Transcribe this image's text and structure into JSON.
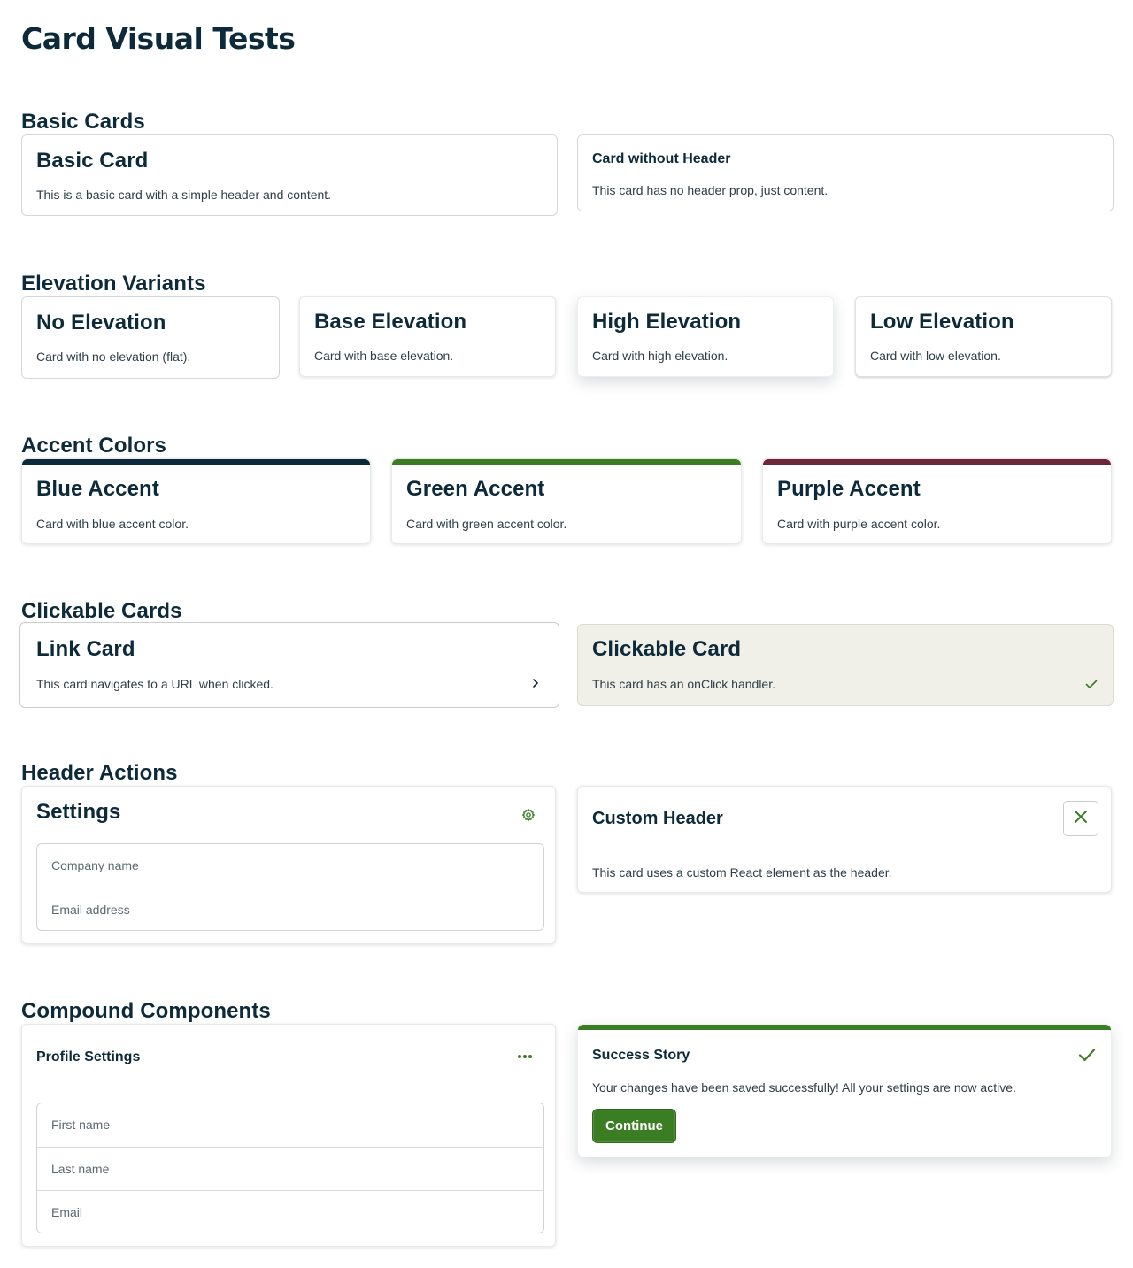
{
  "page": {
    "title": "Card Visual Tests"
  },
  "sections": {
    "basic": "Basic Cards",
    "elevation": "Elevation Variants",
    "accent": "Accent Colors",
    "clickable": "Clickable Cards",
    "header_actions": "Header Actions",
    "compound": "Compound Components"
  },
  "basic_cards": {
    "basic": {
      "title": "Basic Card",
      "body": "This is a basic card with a simple header and content."
    },
    "no_header": {
      "title": "Card without Header",
      "body": "This card has no header prop, just content."
    }
  },
  "elevation_cards": {
    "none": {
      "title": "No Elevation",
      "body": "Card with no elevation (flat)."
    },
    "base": {
      "title": "Base Elevation",
      "body": "Card with base elevation."
    },
    "high": {
      "title": "High Elevation",
      "body": "Card with high elevation."
    },
    "low": {
      "title": "Low Elevation",
      "body": "Card with low elevation."
    }
  },
  "accent_cards": {
    "blue": {
      "title": "Blue Accent",
      "body": "Card with blue accent color.",
      "color": "#0d2a3a"
    },
    "green": {
      "title": "Green Accent",
      "body": "Card with green accent color.",
      "color": "#3a7d22"
    },
    "purple": {
      "title": "Purple Accent",
      "body": "Card with purple accent color.",
      "color": "#6b2637"
    }
  },
  "clickable_cards": {
    "link": {
      "title": "Link Card",
      "body": "This card navigates to a URL when clicked.",
      "icon": "chevron-right-icon"
    },
    "clickable": {
      "title": "Clickable Card",
      "body": "This card has an onClick handler.",
      "icon": "check-icon"
    }
  },
  "header_action_cards": {
    "settings": {
      "title": "Settings",
      "icon": "gear-icon",
      "fields": [
        {
          "placeholder": "Company name"
        },
        {
          "placeholder": "Email address"
        }
      ]
    },
    "custom": {
      "title": "Custom Header",
      "body": "This card uses a custom React element as the header.",
      "icon": "close-icon"
    }
  },
  "compound_cards": {
    "profile": {
      "title": "Profile Settings",
      "icon": "more-horizontal-icon",
      "fields": [
        {
          "placeholder": "First name"
        },
        {
          "placeholder": "Last name"
        },
        {
          "placeholder": "Email"
        }
      ]
    },
    "success": {
      "title": "Success Story",
      "body": "Your changes have been saved successfully! All your settings are now active.",
      "button": "Continue",
      "icon": "check-icon"
    }
  },
  "colors": {
    "primary_text": "#0d2a3a",
    "green": "#3a7d22",
    "purple": "#6b2637",
    "clickable_bg": "#f0efe8"
  }
}
